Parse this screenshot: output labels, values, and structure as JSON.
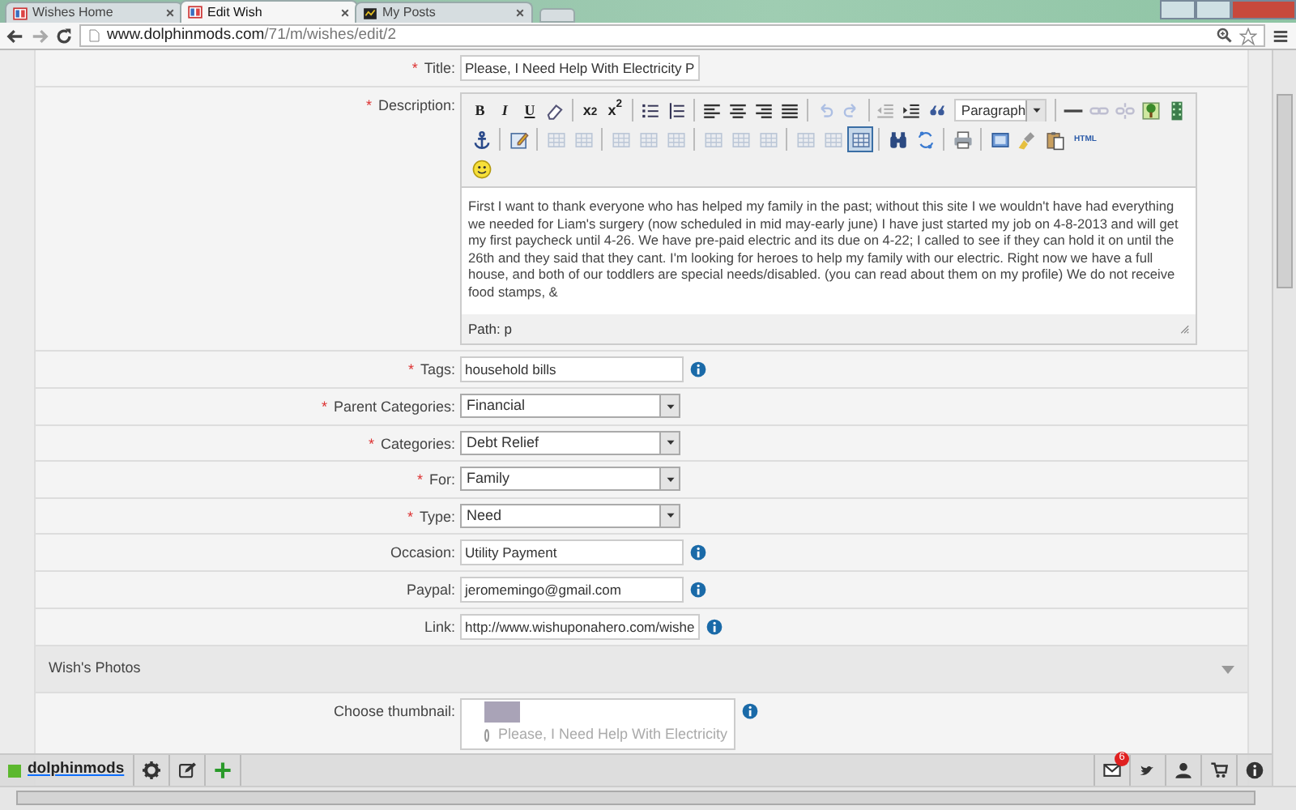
{
  "browser": {
    "tabs": [
      {
        "title": "Wishes Home",
        "kind": "wishes",
        "selected": false
      },
      {
        "title": "Edit Wish",
        "kind": "wishes",
        "selected": true
      },
      {
        "title": "My Posts",
        "kind": "posts",
        "selected": false
      }
    ],
    "url_host": "www.dolphinmods.com",
    "url_path": "/71/m/wishes/edit/2"
  },
  "form": {
    "required_mark": "*",
    "rows": [
      {
        "kind": "text",
        "label": "Title:",
        "required": true,
        "value": "Please, I Need Help With Electricity P",
        "info": false
      },
      {
        "kind": "editor",
        "label": "Description:",
        "required": true
      },
      {
        "kind": "text",
        "label": "Tags:",
        "required": true,
        "value": "household bills",
        "info": true
      },
      {
        "kind": "select",
        "label": "Parent Categories:",
        "required": true,
        "value": "Financial"
      },
      {
        "kind": "select",
        "label": "Categories:",
        "required": true,
        "value": "Debt Relief"
      },
      {
        "kind": "select",
        "label": "For:",
        "required": true,
        "value": "Family"
      },
      {
        "kind": "select",
        "label": "Type:",
        "required": true,
        "value": "Need"
      },
      {
        "kind": "text",
        "label": "Occasion:",
        "required": false,
        "value": "Utility Payment",
        "info": true
      },
      {
        "kind": "text",
        "label": "Paypal:",
        "required": false,
        "value": "jeromemingo@gmail.com",
        "info": true
      },
      {
        "kind": "text",
        "label": "Link:",
        "required": false,
        "value": "http://www.wishuponahero.com/wishe",
        "info": true
      },
      {
        "kind": "section",
        "label": "Wish's Photos",
        "expanded": true
      },
      {
        "kind": "thumbnail",
        "label": "Choose thumbnail:",
        "required": false,
        "info": true,
        "thumbnails": [
          {
            "caption": "Please, I Need Help With Electricity",
            "selected": true
          }
        ]
      }
    ]
  },
  "editor": {
    "toolbar": [
      [
        {
          "kind": "bold",
          "label": "B",
          "disabled": false,
          "pressed": false
        },
        {
          "kind": "italic",
          "label": "I",
          "disabled": false,
          "pressed": false
        },
        {
          "kind": "underline",
          "label": "U",
          "disabled": false,
          "pressed": false
        },
        {
          "kind": "eraser",
          "disabled": false,
          "pressed": false
        },
        {
          "kind": "sep"
        },
        {
          "kind": "subscript",
          "label": "x$_{2}$",
          "disabled": false,
          "pressed": false
        },
        {
          "kind": "superscript",
          "label": "x$^{2}$",
          "disabled": false,
          "pressed": false
        },
        {
          "kind": "sep"
        },
        {
          "kind": "bullets",
          "disabled": false,
          "pressed": false
        },
        {
          "kind": "numbers",
          "disabled": false,
          "pressed": false
        },
        {
          "kind": "sep"
        },
        {
          "kind": "align-left",
          "disabled": false,
          "pressed": false
        },
        {
          "kind": "align-center",
          "disabled": false,
          "pressed": false
        },
        {
          "kind": "align-right",
          "disabled": false,
          "pressed": false
        },
        {
          "kind": "justify",
          "disabled": false,
          "pressed": false
        },
        {
          "kind": "sep"
        },
        {
          "kind": "undo",
          "disabled": true,
          "pressed": false
        },
        {
          "kind": "redo",
          "disabled": true,
          "pressed": false
        },
        {
          "kind": "sep"
        },
        {
          "kind": "outdent",
          "disabled": true,
          "pressed": false
        },
        {
          "kind": "indent",
          "disabled": false,
          "pressed": false
        },
        {
          "kind": "quote",
          "disabled": false,
          "pressed": false
        },
        {
          "kind": "format",
          "value": "Paragraph"
        },
        {
          "kind": "sep"
        },
        {
          "kind": "rule",
          "disabled": false,
          "pressed": false
        },
        {
          "kind": "link",
          "disabled": true,
          "pressed": false
        },
        {
          "kind": "unlink",
          "disabled": true,
          "pressed": false
        },
        {
          "kind": "image",
          "disabled": false,
          "pressed": false
        },
        {
          "kind": "media",
          "disabled": false,
          "pressed": false
        }
      ],
      [
        {
          "kind": "anchor",
          "disabled": false,
          "pressed": false
        },
        {
          "kind": "sep"
        },
        {
          "kind": "note",
          "disabled": false,
          "pressed": false
        },
        {
          "kind": "sep"
        },
        {
          "kind": "table",
          "disabled": true,
          "pressed": false
        },
        {
          "kind": "table",
          "disabled": true,
          "pressed": false
        },
        {
          "kind": "sep"
        },
        {
          "kind": "table",
          "disabled": true,
          "pressed": false
        },
        {
          "kind": "table",
          "disabled": true,
          "pressed": false
        },
        {
          "kind": "table",
          "disabled": true,
          "pressed": false
        },
        {
          "kind": "sep"
        },
        {
          "kind": "table",
          "disabled": true,
          "pressed": false
        },
        {
          "kind": "table",
          "disabled": true,
          "pressed": false
        },
        {
          "kind": "table",
          "disabled": true,
          "pressed": false
        },
        {
          "kind": "sep"
        },
        {
          "kind": "table",
          "disabled": true,
          "pressed": false
        },
        {
          "kind": "table",
          "disabled": true,
          "pressed": false
        },
        {
          "kind": "table",
          "disabled": false,
          "pressed": true
        },
        {
          "kind": "sep"
        },
        {
          "kind": "find",
          "disabled": false,
          "pressed": false
        },
        {
          "kind": "replace",
          "disabled": false,
          "pressed": false
        },
        {
          "kind": "sep"
        },
        {
          "kind": "print",
          "disabled": false,
          "pressed": false
        },
        {
          "kind": "sep"
        },
        {
          "kind": "fullscreen",
          "disabled": false,
          "pressed": false
        },
        {
          "kind": "clean",
          "disabled": false,
          "pressed": false
        },
        {
          "kind": "paste",
          "disabled": false,
          "pressed": false
        },
        {
          "kind": "html",
          "label": "HTML",
          "disabled": false,
          "pressed": false
        }
      ],
      [
        {
          "kind": "smiley",
          "disabled": false,
          "pressed": false
        }
      ]
    ],
    "body": "First I want to thank everyone who has helped my family in the past; without this site I we wouldn't have had everything we needed for Liam's surgery (now scheduled in mid may-early june) I have just started my job on 4-8-2013 and will get my first paycheck until 4-26. We have pre-paid electric and its due on 4-22; I called to see if they can hold it on until the 26th and they said that they cant. I'm looking for heroes to help my family with our electric. Right now we have a full house, and both of our toddlers are special needs/disabled. (you can read about them on my profile) We do not receive food stamps, &",
    "path": "Path: p"
  },
  "bottom_bar": {
    "brand": "dolphinmods",
    "mail_badge": "6"
  }
}
